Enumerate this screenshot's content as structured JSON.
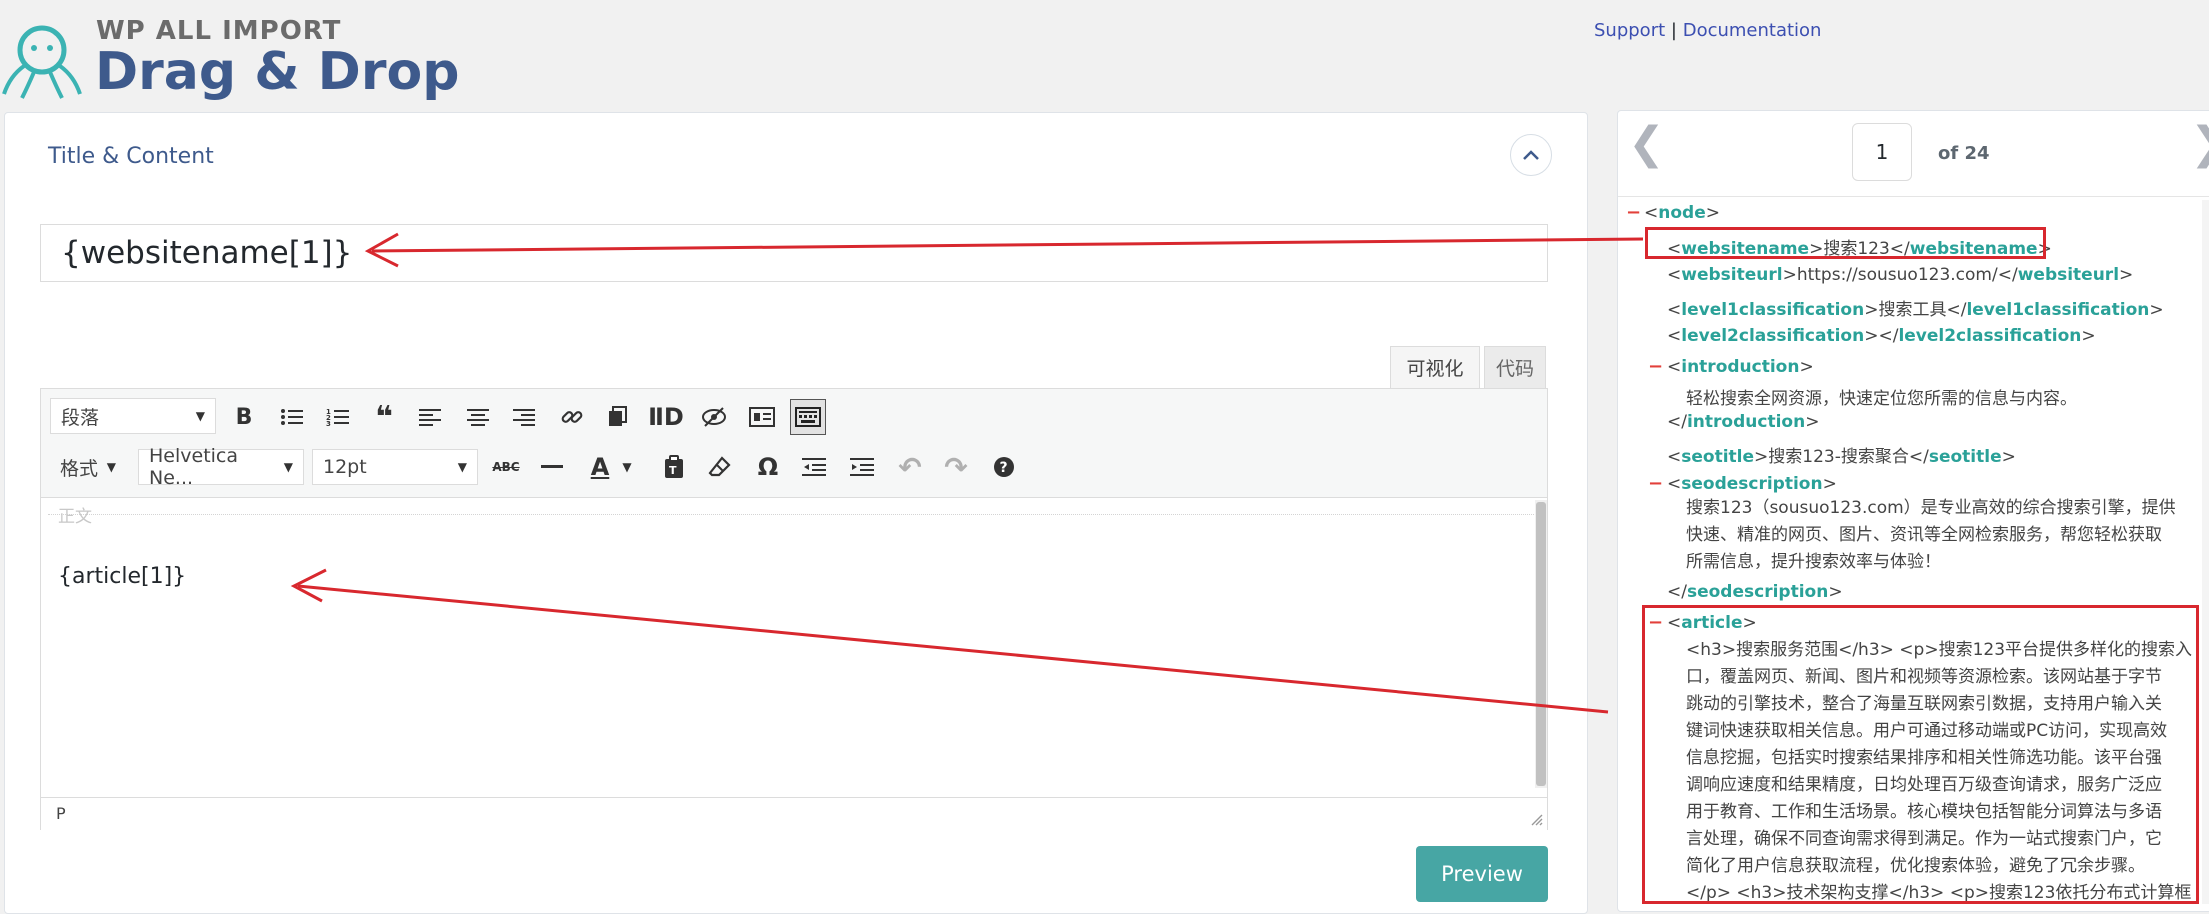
{
  "header": {
    "brand_top": "WP ALL IMPORT",
    "brand_main": "Drag & Drop",
    "support_link": "Support",
    "separator": "|",
    "documentation_link": "Documentation"
  },
  "section": {
    "title": "Title & Content",
    "title_field_value": "{websitename[1]}"
  },
  "editor": {
    "tab_visual": "可视化",
    "tab_code": "代码",
    "paragraph_select": "段落",
    "format_menu": "格式",
    "font_family": "Helvetica Ne...",
    "font_size": "12pt",
    "placeholder": "正文",
    "content": "{article[1]}",
    "status_path": "P"
  },
  "preview_button": "Preview",
  "pager": {
    "current": "1",
    "of_label": "of 24"
  },
  "xml": {
    "node_tag": "node",
    "websitename": {
      "tag": "websitename",
      "value": "搜索123"
    },
    "websiteurl": {
      "tag": "websiteurl",
      "value": "https://sousuo123.com/"
    },
    "level1": {
      "tag": "level1classification",
      "value": "搜索工具"
    },
    "level2": {
      "tag": "level2classification",
      "value": ""
    },
    "introduction": {
      "tag": "introduction",
      "value": "轻松搜索全网资源，快速定位您所需的信息与内容。"
    },
    "seotitle": {
      "tag": "seotitle",
      "value": "搜索123-搜索聚合"
    },
    "seodescription": {
      "tag": "seodescription",
      "lines": [
        "搜索123（sousuo123.com）是专业高效的综合搜索引擎，提供",
        "快速、精准的网页、图片、资讯等全网检索服务，帮您轻松获取",
        "所需信息，提升搜索效率与体验！"
      ]
    },
    "article": {
      "tag": "article",
      "lines": [
        "<h3>搜索服务范围</h3> <p>搜索123平台提供多样化的搜索入",
        "口，覆盖网页、新闻、图片和视频等资源检索。该网站基于字节",
        "跳动的引擎技术，整合了海量互联网索引数据，支持用户输入关",
        "键词快速获取相关信息。用户可通过移动端或PC访问，实现高效",
        "信息挖掘，包括实时搜索结果排序和相关性筛选功能。该平台强",
        "调响应速度和结果精度，日均处理百万级查询请求，服务广泛应",
        "用于教育、工作和生活场景。核心模块包括智能分词算法与多语",
        "言处理，确保不同查询需求得到满足。作为一站式搜索门户，它",
        "简化了用户信息获取流程，优化搜索体验，避免了冗余步骤。",
        "</p> <h3>技术架构支撑</h3> <p>搜索123依托分布式计算框"
      ]
    }
  },
  "colors": {
    "brand": "#3e5a8c",
    "tag": "#2aa198",
    "annotation_red": "#d8282e",
    "preview_button": "#47a6a4"
  }
}
